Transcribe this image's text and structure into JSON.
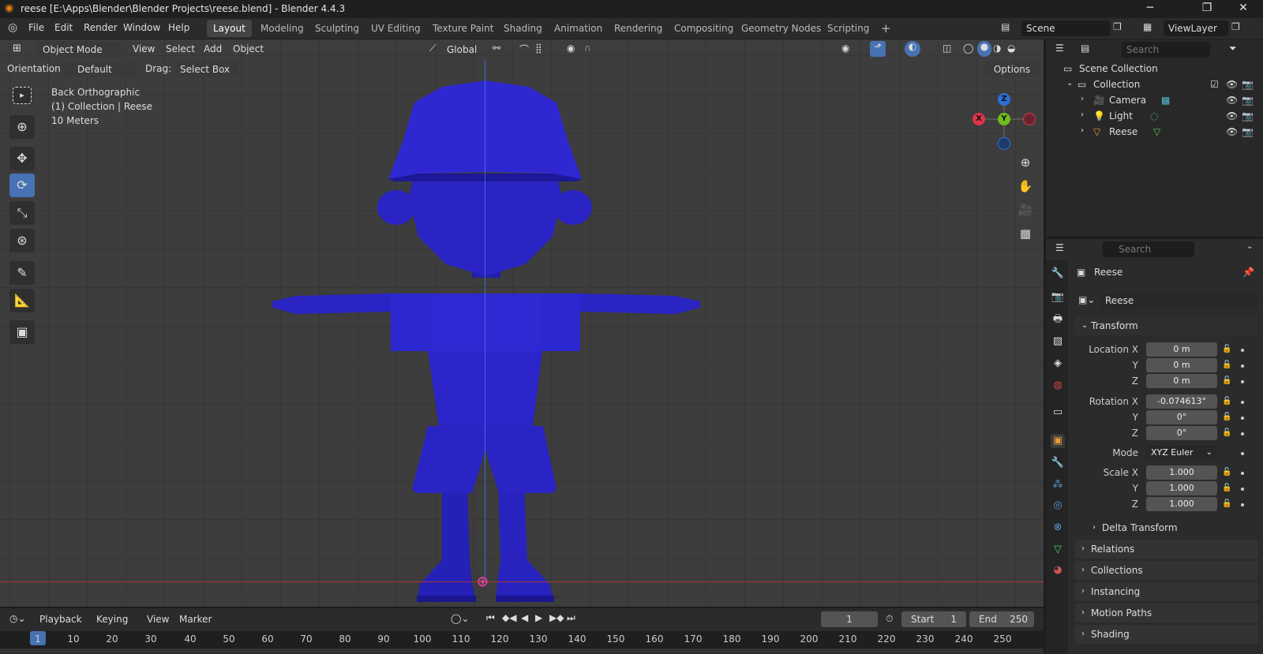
{
  "window": {
    "title": "reese [E:\\Apps\\Blender\\Blender Projects\\reese.blend] - Blender 4.4.3",
    "minimize": "─",
    "maximize": "❐",
    "close": "✕"
  },
  "menu": [
    "File",
    "Edit",
    "Render",
    "Window",
    "Help"
  ],
  "workspaces": [
    "Layout",
    "Modeling",
    "Sculpting",
    "UV Editing",
    "Texture Paint",
    "Shading",
    "Animation",
    "Rendering",
    "Compositing",
    "Geometry Nodes",
    "Scripting"
  ],
  "active_workspace": "Layout",
  "add_workspace": "+",
  "scene": "Scene",
  "view_layer": "ViewLayer",
  "viewport": {
    "mode": "Object Mode",
    "menus": [
      "View",
      "Select",
      "Add",
      "Object"
    ],
    "transform_orientation": "Global",
    "orientation_label": "Orientation:",
    "orientation_value": "Default",
    "drag_label": "Drag:",
    "drag_value": "Select Box",
    "options": "Options",
    "overlay_lines": [
      "Back Orthographic",
      "(1) Collection | Reese",
      "10 Meters"
    ],
    "gizmo": {
      "x": "X",
      "y": "Y",
      "z": "Z"
    }
  },
  "outliner": {
    "search_placeholder": "Search",
    "scene_collection": "Scene Collection",
    "collection": "Collection",
    "items": [
      "Camera",
      "Light",
      "Reese"
    ]
  },
  "properties": {
    "search_placeholder": "Search",
    "object_name": "Reese",
    "data_name": "Reese",
    "transform_header": "Transform",
    "location": {
      "label": "Location X",
      "x": "0 m",
      "y": "0 m",
      "z": "0 m"
    },
    "rotation": {
      "label": "Rotation X",
      "x": "-0.074613°",
      "y": "0°",
      "z": "0°"
    },
    "mode_label": "Mode",
    "mode_value": "XYZ Euler",
    "scale": {
      "label": "Scale X",
      "x": "1.000",
      "y": "1.000",
      "z": "1.000"
    },
    "axis_y": "Y",
    "axis_z": "Z",
    "delta_transform": "Delta Transform",
    "panels": [
      "Relations",
      "Collections",
      "Instancing",
      "Motion Paths",
      "Shading"
    ]
  },
  "timeline": {
    "menus": [
      "Playback",
      "Keying",
      "View",
      "Marker"
    ],
    "current_frame": "1",
    "start_label": "Start",
    "start": "1",
    "end_label": "End",
    "end": "250",
    "ticks": [
      "1",
      "10",
      "20",
      "30",
      "40",
      "50",
      "60",
      "70",
      "80",
      "90",
      "100",
      "110",
      "120",
      "130",
      "140",
      "150",
      "160",
      "170",
      "180",
      "190",
      "200",
      "210",
      "220",
      "230",
      "240",
      "250"
    ]
  },
  "colors": {
    "mesh": "#2a22c8",
    "accent": "#4772b3",
    "x_axis": "#e0344c",
    "y_axis": "#6fbd1a",
    "z_axis": "#2e6fd6"
  }
}
